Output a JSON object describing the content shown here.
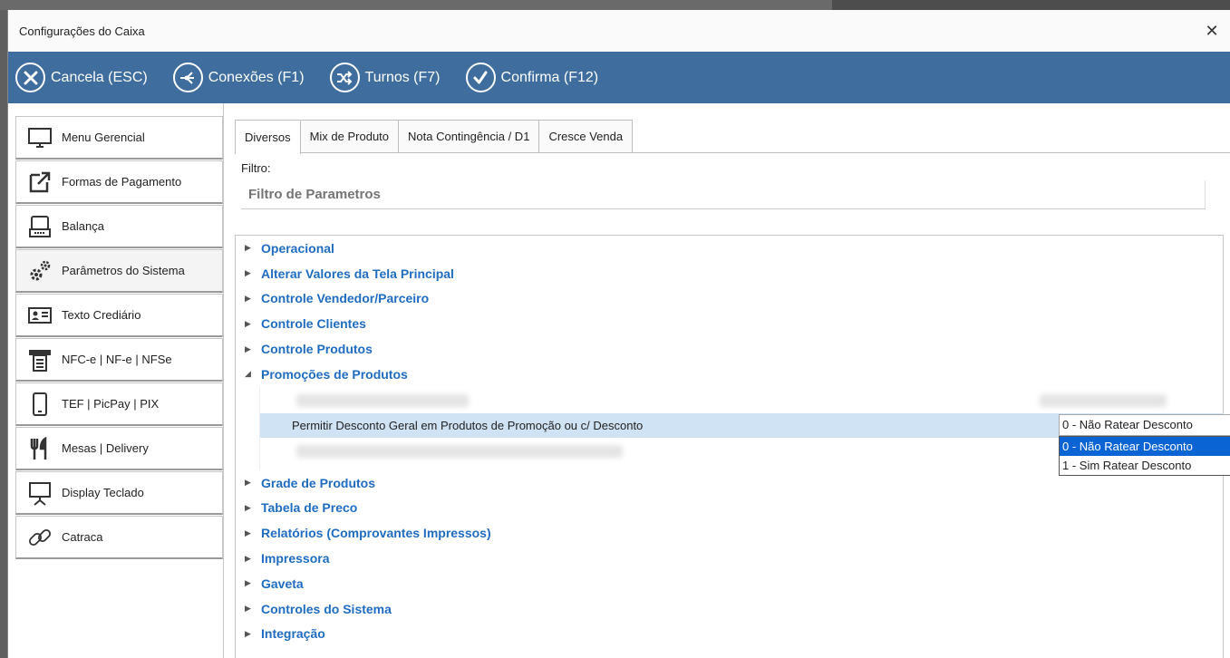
{
  "window": {
    "title": "Configurações do Caixa",
    "close_glyph": "✕"
  },
  "toolbar": {
    "buttons": [
      {
        "label": "Cancela (ESC)",
        "icon": "cancel-circle-icon"
      },
      {
        "label": "Conexões (F1)",
        "icon": "connections-icon"
      },
      {
        "label": "Turnos (F7)",
        "icon": "shuffle-icon"
      },
      {
        "label": "Confirma (F12)",
        "icon": "check-circle-icon"
      }
    ]
  },
  "sidebar": {
    "items": [
      {
        "label": "Menu Gerencial",
        "icon": "monitor-icon"
      },
      {
        "label": "Formas de Pagamento",
        "icon": "external-link-icon"
      },
      {
        "label": "Balança",
        "icon": "scale-icon"
      },
      {
        "label": "Parâmetros do Sistema",
        "icon": "gears-icon"
      },
      {
        "label": "Texto Crediário",
        "icon": "id-card-icon"
      },
      {
        "label": "NFC-e | NF-e | NFSe",
        "icon": "receipt-printer-icon"
      },
      {
        "label": "TEF | PicPay | PIX",
        "icon": "smartphone-icon"
      },
      {
        "label": "Mesas | Delivery",
        "icon": "cutlery-icon"
      },
      {
        "label": "Display Teclado",
        "icon": "presentation-board-icon"
      },
      {
        "label": "Catraca",
        "icon": "chain-link-icon"
      }
    ]
  },
  "tabs": [
    "Diversos",
    "Mix de Produto",
    "Nota Contingência / D1",
    "Cresce Venda"
  ],
  "filter": {
    "label": "Filtro:",
    "placeholder": "Filtro de Parametros"
  },
  "tree": {
    "groups_before": [
      "Operacional",
      "Alterar Valores da Tela Principal",
      "Controle Vendedor/Parceiro",
      "Controle Clientes",
      "Controle Produtos"
    ],
    "expanded_group": "Promoções de Produtos",
    "selected_param": "Permitir Desconto Geral em Produtos de Promoção ou c/ Desconto",
    "combo_value": "0 - Não Ratear Desconto",
    "options": [
      "0 - Não Ratear Desconto",
      "1 - Sim Ratear Desconto"
    ],
    "groups_after": [
      "Grade de Produtos",
      "Tabela de Preco",
      "Relatórios (Comprovantes Impressos)",
      "Impressora",
      "Gaveta",
      "Controles do Sistema",
      "Integração"
    ]
  },
  "colors": {
    "toolbar": "#3f6d9e",
    "group_text": "#1f6cc1",
    "selection": "#cfe3f4",
    "option_selected": "#0a64d4"
  }
}
